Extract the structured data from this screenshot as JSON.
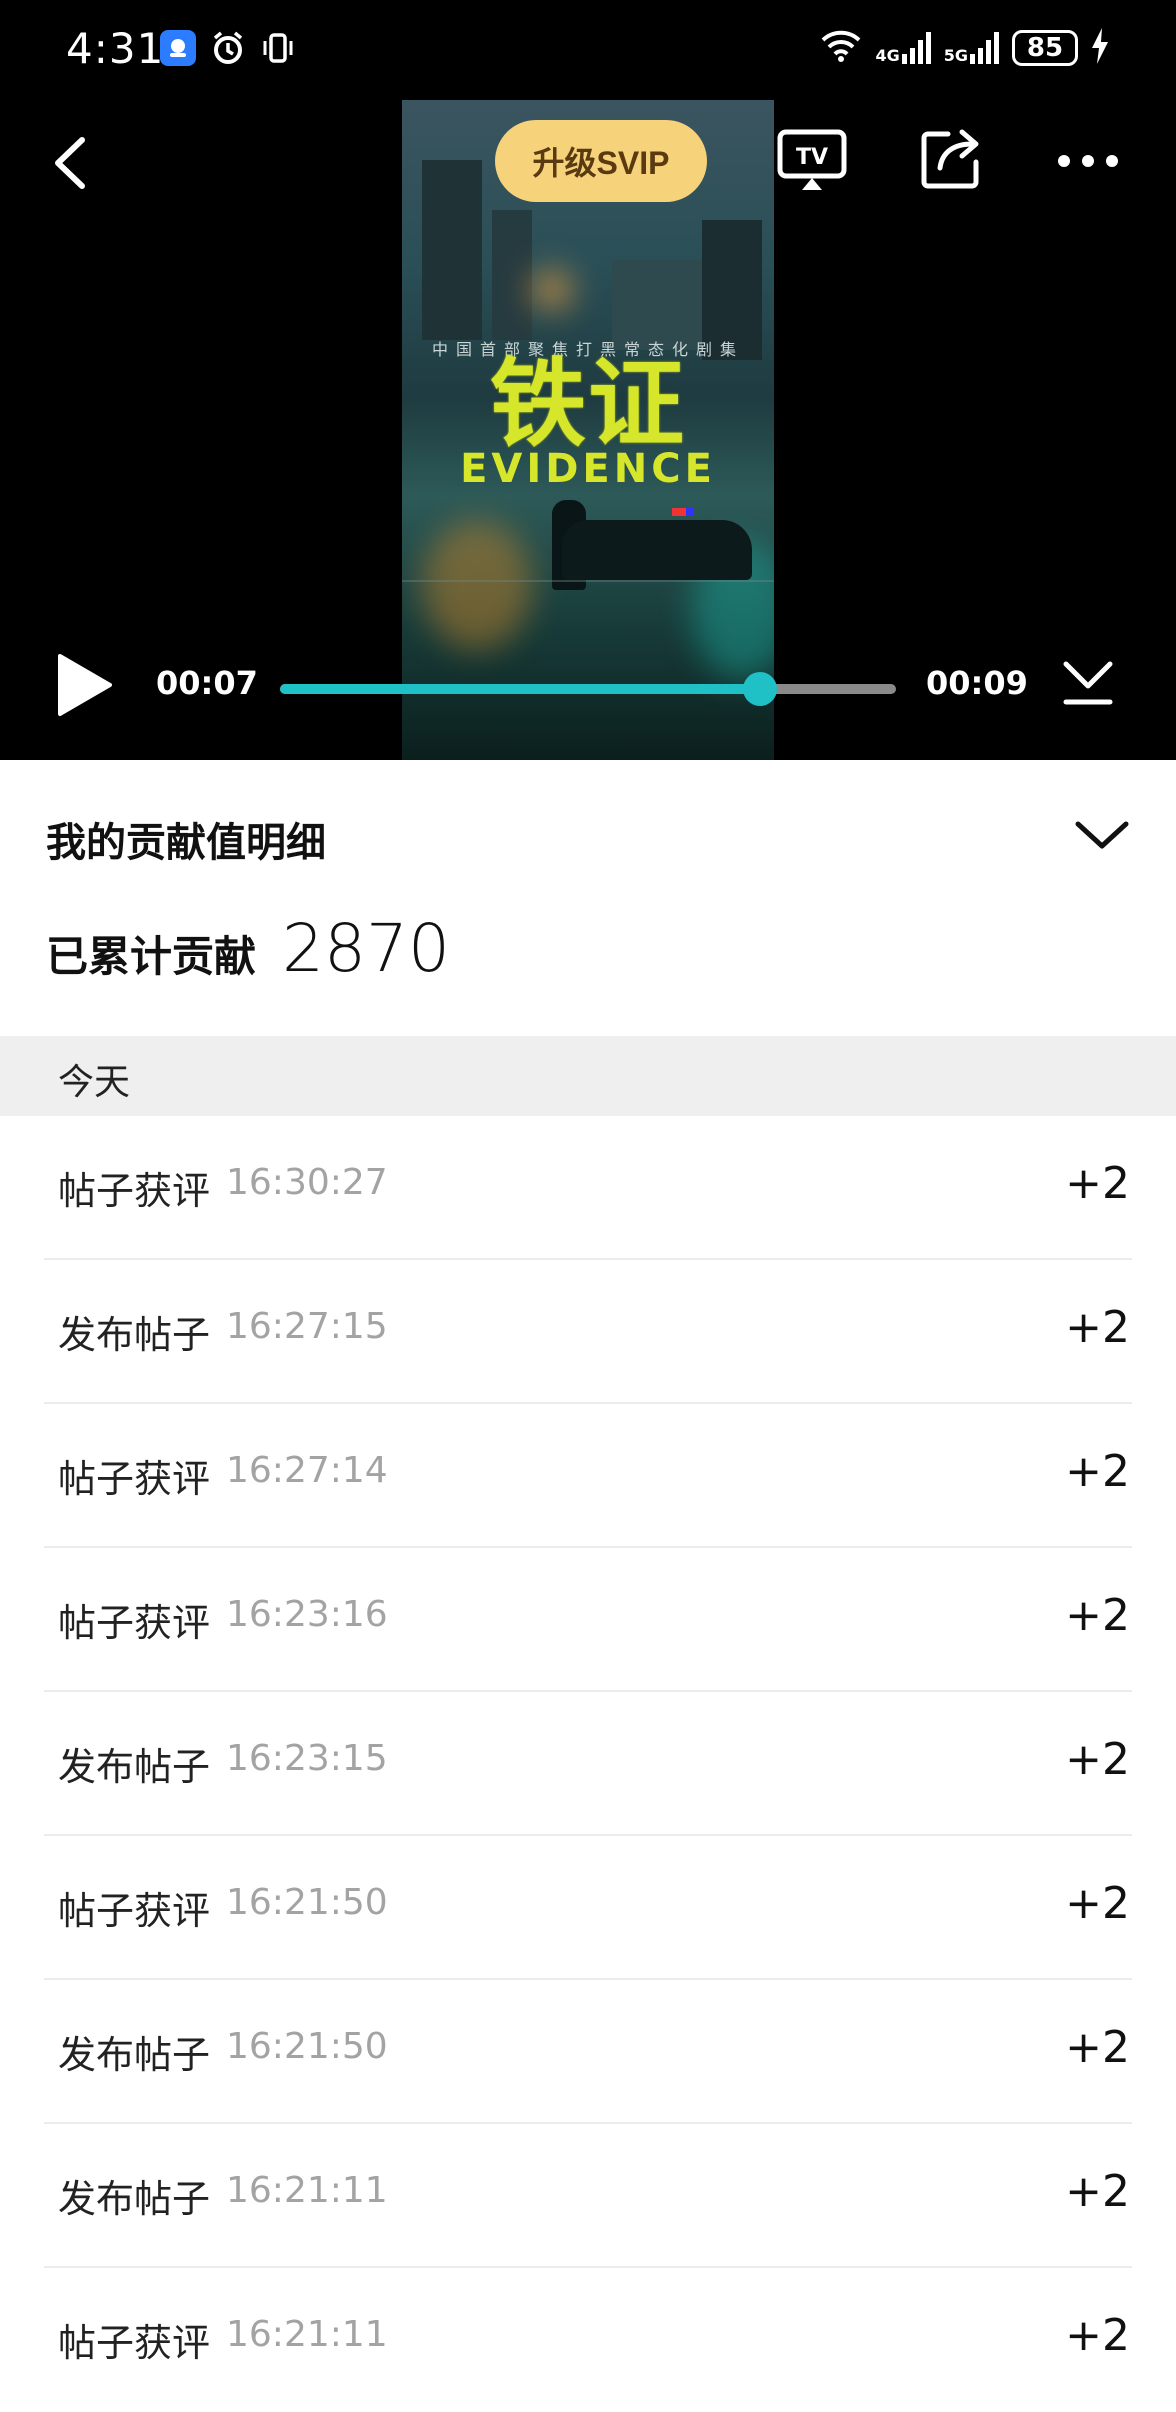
{
  "status_bar": {
    "time": "4:31",
    "battery": "85",
    "network_a": "4G",
    "network_b": "5G"
  },
  "player": {
    "svip_label": "升级SVIP",
    "tv_label": "TV",
    "current_time": "00:07",
    "total_time": "00:09",
    "progress": 0.78,
    "poster": {
      "tagline": "中国首部聚焦打黑常态化剧集",
      "title": "铁证",
      "subtitle": "EVIDENCE"
    }
  },
  "contribution": {
    "title": "我的贡献值明细",
    "total_label": "已累计贡献",
    "total_value": "2870",
    "section_label": "今天",
    "rows": [
      {
        "label": "帖子获评",
        "time": "16:30:27",
        "points": "+2"
      },
      {
        "label": "发布帖子",
        "time": "16:27:15",
        "points": "+2"
      },
      {
        "label": "帖子获评",
        "time": "16:27:14",
        "points": "+2"
      },
      {
        "label": "帖子获评",
        "time": "16:23:16",
        "points": "+2"
      },
      {
        "label": "发布帖子",
        "time": "16:23:15",
        "points": "+2"
      },
      {
        "label": "帖子获评",
        "time": "16:21:50",
        "points": "+2"
      },
      {
        "label": "发布帖子",
        "time": "16:21:50",
        "points": "+2"
      },
      {
        "label": "发布帖子",
        "time": "16:21:11",
        "points": "+2"
      },
      {
        "label": "帖子获评",
        "time": "16:21:11",
        "points": "+2"
      }
    ]
  },
  "colors": {
    "accent": "#1fc0c6",
    "svip_bg": "#f6d27a",
    "section_bg": "#efefef"
  }
}
